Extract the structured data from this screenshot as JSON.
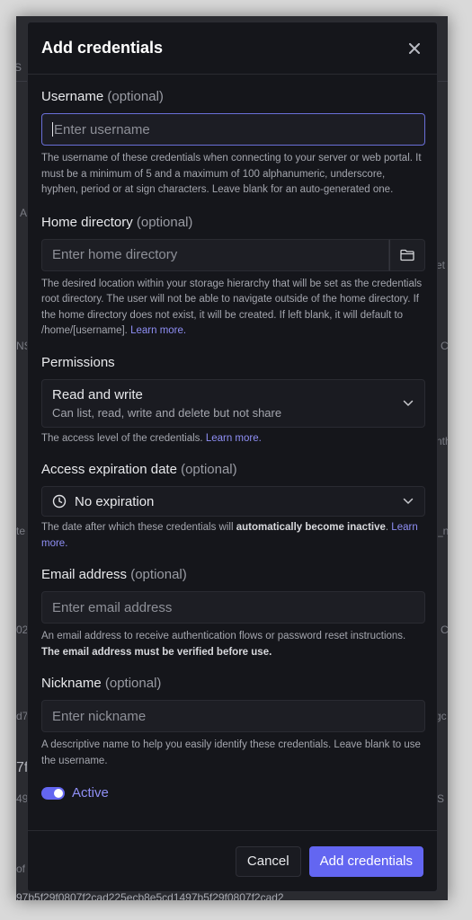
{
  "modal": {
    "title": "Add credentials",
    "close_icon": "close-icon"
  },
  "username": {
    "label": "Username",
    "optional": "(optional)",
    "placeholder": "Enter username",
    "help": "The username of these credentials when connecting to your server or web portal. It must be a minimum of 5 and a maximum of 100 alphanumeric, underscore, hyphen, period or at sign characters. Leave blank for an auto-generated one."
  },
  "home_directory": {
    "label": "Home directory",
    "optional": "(optional)",
    "placeholder": "Enter home directory",
    "button_icon": "folder-icon",
    "help": "The desired location within your storage hierarchy that will be set as the credentials root directory. The user will not be able to navigate outside of the home directory. If the home directory does not exist, it will be created. If left blank, it will default to /home/[username].",
    "link": "Learn more."
  },
  "permissions": {
    "label": "Permissions",
    "selected_title": "Read and write",
    "selected_subtitle": "Can list, read, write and delete but not share",
    "help": "The access level of the credentials.",
    "link": "Learn more."
  },
  "expiration": {
    "label": "Access expiration date",
    "optional": "(optional)",
    "selected": "No expiration",
    "icon": "clock-icon",
    "help_prefix": "The date after which these credentials will",
    "help_bold": "automatically become inactive",
    "help_suffix": ".",
    "link": "Learn more."
  },
  "email": {
    "label": "Email address",
    "optional": "(optional)",
    "placeholder": "Enter email address",
    "help": "An email address to receive authentication flows or password reset instructions.",
    "help_bold": "The email address must be verified before use."
  },
  "nickname": {
    "label": "Nickname",
    "optional": "(optional)",
    "placeholder": "Enter nickname",
    "help": "A descriptive name to help you easily identify these credentials. Leave blank to use the username."
  },
  "active": {
    "label": "Active",
    "enabled": true
  },
  "footer": {
    "cancel_label": "Cancel",
    "submit_label": "Add credentials"
  },
  "background": {
    "fragments": [
      "S",
      "A",
      "et",
      "NS",
      "C",
      "nth",
      "te",
      "_n",
      "02",
      "C",
      "d7",
      "gc",
      "7f",
      "49",
      "S",
      "of t"
    ],
    "bottom_text": "97b5f29f0807f2cad225ecb8e5cd1497b5f29f0807f2cad2"
  },
  "colors": {
    "accent": "#6366f1",
    "link": "#8f8ff5",
    "modal_bg": "#15161b"
  }
}
